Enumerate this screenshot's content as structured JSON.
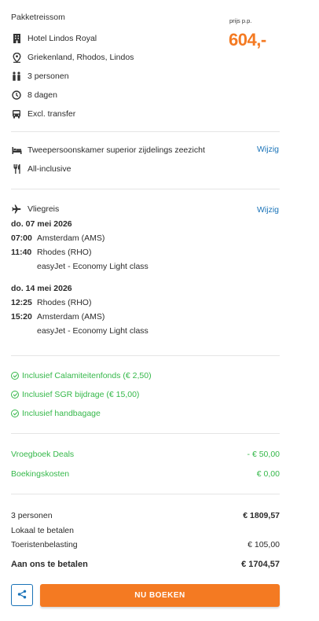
{
  "header": {
    "title": "Pakketreissom",
    "price_label": "prijs p.p.",
    "price": "604,-"
  },
  "package": [
    {
      "icon": "building-icon",
      "text": "Hotel Lindos Royal"
    },
    {
      "icon": "location-pin-icon",
      "text": "Griekenland, Rhodos, Lindos"
    },
    {
      "icon": "persons-icon",
      "text": "3 personen"
    },
    {
      "icon": "clock-icon",
      "text": "8 dagen"
    },
    {
      "icon": "bus-icon",
      "text": "Excl. transfer"
    }
  ],
  "room": {
    "room_text": "Tweepersoonskamer superior zijdelings zeezicht",
    "board_text": "All-inclusive",
    "change_label": "Wijzig"
  },
  "flight": {
    "label": "Vliegreis",
    "change_label": "Wijzig",
    "outbound": {
      "date": "do. 07 mei 2026",
      "dep_time": "07:00",
      "dep_place": "Amsterdam (AMS)",
      "arr_time": "11:40",
      "arr_place": "Rhodes (RHO)",
      "carrier": "easyJet - Economy Light class"
    },
    "return": {
      "date": "do. 14 mei 2026",
      "dep_time": "12:25",
      "dep_place": "Rhodes (RHO)",
      "arr_time": "15:20",
      "arr_place": "Amsterdam (AMS)",
      "carrier": "easyJet - Economy Light class"
    }
  },
  "inclusions": [
    "Inclusief Calamiteitenfonds (€ 2,50)",
    "Inclusief SGR bijdrage (€ 15,00)",
    "Inclusief handbagage"
  ],
  "discounts": {
    "early_label": "Vroegboek Deals",
    "early_value": "- € 50,00",
    "booking_label": "Boekingskosten",
    "booking_value": "€ 0,00"
  },
  "summary": {
    "persons_label": "3 personen",
    "persons_value": "€ 1809,57",
    "local_label": "Lokaal te betalen",
    "tax_label": "Toeristenbelasting",
    "tax_value": "€ 105,00",
    "total_label": "Aan ons te betalen",
    "total_value": "€ 1704,57"
  },
  "actions": {
    "book_label": "NU BOEKEN"
  },
  "colors": {
    "accent": "#f47a22",
    "link": "#1a73b8",
    "green": "#35b84a"
  }
}
